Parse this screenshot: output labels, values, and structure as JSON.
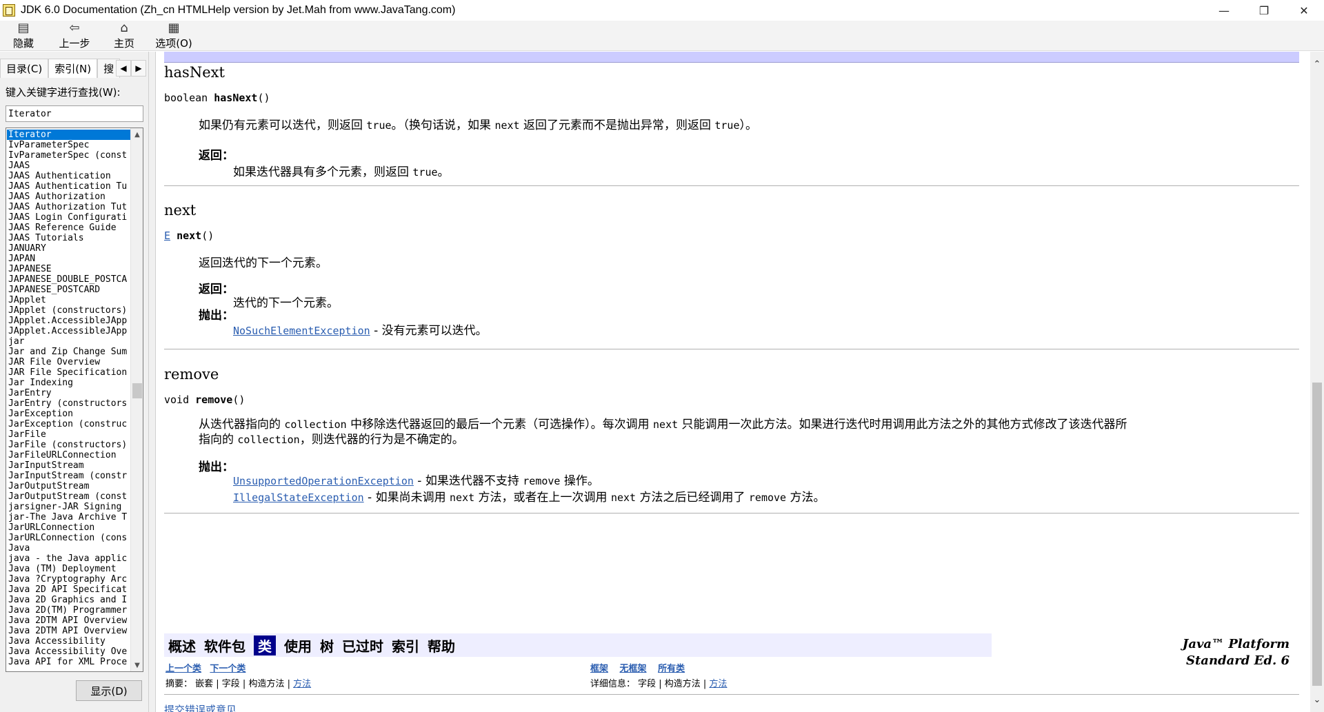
{
  "window": {
    "title": "JDK 6.0 Documentation (Zh_cn HTMLHelp version by Jet.Mah from www.JavaTang.com)",
    "controls": {
      "minimize": "—",
      "restore": "❐",
      "close": "✕"
    }
  },
  "toolbar": {
    "hide": "隐藏",
    "back": "上一步",
    "home": "主页",
    "options": "选项(O)"
  },
  "sidebar": {
    "tabs": [
      "目录(C)",
      "索引(N)",
      "搜"
    ],
    "tab_scroll": [
      "◀",
      "▶"
    ],
    "keyword_label": "键入关键字进行查找(W):",
    "keyword_value": "Iterator",
    "display_button": "显示(D)",
    "index_items": [
      "Iterator",
      "IvParameterSpec",
      "IvParameterSpec (const",
      "JAAS",
      "JAAS Authentication",
      "JAAS Authentication Tu",
      "JAAS Authorization",
      "JAAS Authorization Tut",
      "JAAS Login Configurati",
      "JAAS Reference Guide",
      "JAAS Tutorials",
      "JANUARY",
      "JAPAN",
      "JAPANESE",
      "JAPANESE_DOUBLE_POSTCA",
      "JAPANESE_POSTCARD",
      "JApplet",
      "JApplet (constructors)",
      "JApplet.AccessibleJApp",
      "JApplet.AccessibleJApp",
      "jar",
      "Jar and Zip Change Sum",
      "JAR File Overview",
      "JAR File Specification",
      "Jar Indexing",
      "JarEntry",
      "JarEntry (constructors",
      "JarException",
      "JarException (construc",
      "JarFile",
      "JarFile (constructors)",
      "JarFileURLConnection",
      "JarInputStream",
      "JarInputStream (constr",
      "JarOutputStream",
      "JarOutputStream (const",
      "jarsigner-JAR Signing",
      "jar-The Java Archive T",
      "JarURLConnection",
      "JarURLConnection (cons",
      "Java",
      "java - the Java applic",
      "Java (TM) Deployment",
      "Java ?Cryptography Arc",
      "Java 2D API Specificat",
      "Java 2D Graphics and I",
      "Java 2D(TM) Programmer",
      "Java 2DTM API Overview",
      "Java 2DTM API Overview",
      "Java Accessibility",
      "Java Accessibility Ove",
      "Java API for XML Proce"
    ]
  },
  "content": {
    "hasNext": {
      "title": "hasNext",
      "sig_type": "boolean",
      "sig_name": "hasNext",
      "sig_paren": "()",
      "desc_1": "如果仍有元素可以迭代，则返回 ",
      "desc_code1": "true",
      "desc_2": "。（换句话说，如果 ",
      "desc_code2": "next",
      "desc_3": " 返回了元素而不是抛出异常，则返回 ",
      "desc_code3": "true",
      "desc_4": "）。",
      "returns_label": "返回：",
      "returns_text": "如果迭代器具有多个元素，则返回 ",
      "returns_code": "true",
      "returns_end": "。"
    },
    "next": {
      "title": "next",
      "sig_type": "E",
      "sig_name": "next",
      "sig_paren": "()",
      "desc": "返回迭代的下一个元素。",
      "returns_label": "返回：",
      "returns_text": "迭代的下一个元素。",
      "throws_label": "抛出：",
      "throws_link": "NoSuchElementException",
      "throws_text": " - 没有元素可以迭代。"
    },
    "remove": {
      "title": "remove",
      "sig_type": "void",
      "sig_name": "remove",
      "sig_paren": "()",
      "desc_1": "从迭代器指向的 ",
      "desc_code1": "collection",
      "desc_2": " 中移除迭代器返回的最后一个元素（可选操作）。每次调用 ",
      "desc_code2": "next",
      "desc_3": " 只能调用一次此方法。如果进行迭代时用调用此方法之外的其他方式修改了该迭代器所",
      "desc_line2_a": "指向的 ",
      "desc_line2_code": "collection",
      "desc_line2_b": "，则迭代器的行为是不确定的。",
      "throws_label": "抛出：",
      "throws_1_link": "UnsupportedOperationException",
      "throws_1_a": " - 如果迭代器不支持 ",
      "throws_1_code": "remove",
      "throws_1_b": " 操作。",
      "throws_2_link": "IllegalStateException",
      "throws_2_a": " - 如果尚未调用 ",
      "throws_2_code1": "next",
      "throws_2_b": " 方法，或者在上一次调用 ",
      "throws_2_code2": "next",
      "throws_2_c": " 方法之后已经调用了 ",
      "throws_2_code3": "remove",
      "throws_2_d": " 方法。"
    },
    "navbar": {
      "items": [
        "概述",
        "软件包",
        "类",
        "使用",
        "树",
        "已过时",
        "索引",
        "帮助"
      ],
      "current_index": 2
    },
    "platform_line1": "Java™ Platform",
    "platform_line2": "Standard Ed. 6",
    "subnav": {
      "prev_class": "上一个类",
      "next_class": "下一个类",
      "frames": "框架",
      "no_frames": "无框架",
      "all_classes": "所有类",
      "summary_label": "摘要：",
      "summary_items": "嵌套 | 字段 | 构造方法 | ",
      "summary_method": "方法",
      "detail_label": "详细信息：",
      "detail_items": "字段 | 构造方法 | ",
      "detail_method": "方法"
    },
    "bottom_link": "提交错误或意见"
  },
  "colors": {
    "selected_bg": "#0078d7",
    "nav_bg": "#eeeeff",
    "nav_current": "#00008b",
    "link": "#2a5db0",
    "top_strip": "#ccccff"
  }
}
